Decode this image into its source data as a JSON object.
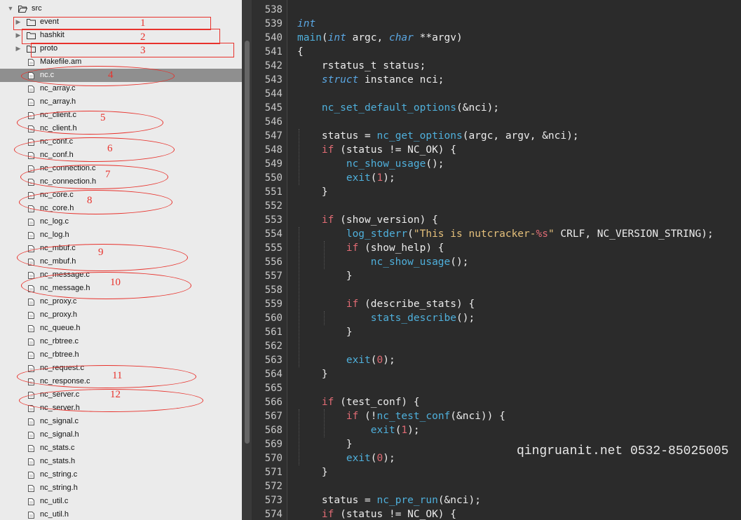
{
  "sidebar": {
    "root": {
      "label": "src",
      "expanded": true
    },
    "folders": [
      {
        "label": "event",
        "expanded": false
      },
      {
        "label": "hashkit",
        "expanded": false
      },
      {
        "label": "proto",
        "expanded": false
      }
    ],
    "files": [
      {
        "label": "Makefile.am",
        "selected": false
      },
      {
        "label": "nc.c",
        "selected": true
      },
      {
        "label": "nc_array.c"
      },
      {
        "label": "nc_array.h"
      },
      {
        "label": "nc_client.c"
      },
      {
        "label": "nc_client.h"
      },
      {
        "label": "nc_conf.c"
      },
      {
        "label": "nc_conf.h"
      },
      {
        "label": "nc_connection.c"
      },
      {
        "label": "nc_connection.h"
      },
      {
        "label": "nc_core.c"
      },
      {
        "label": "nc_core.h"
      },
      {
        "label": "nc_log.c"
      },
      {
        "label": "nc_log.h"
      },
      {
        "label": "nc_mbuf.c"
      },
      {
        "label": "nc_mbuf.h"
      },
      {
        "label": "nc_message.c"
      },
      {
        "label": "nc_message.h"
      },
      {
        "label": "nc_proxy.c"
      },
      {
        "label": "nc_proxy.h"
      },
      {
        "label": "nc_queue.h"
      },
      {
        "label": "nc_rbtree.c"
      },
      {
        "label": "nc_rbtree.h"
      },
      {
        "label": "nc_request.c"
      },
      {
        "label": "nc_response.c"
      },
      {
        "label": "nc_server.c"
      },
      {
        "label": "nc_server.h"
      },
      {
        "label": "nc_signal.c"
      },
      {
        "label": "nc_signal.h"
      },
      {
        "label": "nc_stats.c"
      },
      {
        "label": "nc_stats.h"
      },
      {
        "label": "nc_string.c"
      },
      {
        "label": "nc_string.h"
      },
      {
        "label": "nc_util.c"
      },
      {
        "label": "nc_util.h"
      }
    ]
  },
  "annotations": [
    "1",
    "2",
    "3",
    "4",
    "5",
    "6",
    "7",
    "8",
    "9",
    "10",
    "11",
    "12"
  ],
  "colors": {
    "annotation": "#e8322c",
    "keyword": "#5aa7e3",
    "function": "#4fb0dc",
    "control": "#e06b74",
    "string": "#e5c07b"
  },
  "editor": {
    "lines": [
      {
        "n": "538",
        "t": []
      },
      {
        "n": "539",
        "t": [
          [
            "kw",
            "int"
          ]
        ]
      },
      {
        "n": "540",
        "t": [
          [
            "fn",
            "main"
          ],
          [
            "p",
            "("
          ],
          [
            "kw",
            "int"
          ],
          [
            "p",
            " argc, "
          ],
          [
            "kw",
            "char"
          ],
          [
            "p",
            " **argv)"
          ]
        ]
      },
      {
        "n": "541",
        "t": [
          [
            "p",
            "{"
          ]
        ]
      },
      {
        "n": "542",
        "t": [
          [
            "p",
            "    rstatus_t status;"
          ]
        ]
      },
      {
        "n": "543",
        "t": [
          [
            "p",
            "    "
          ],
          [
            "kw",
            "struct"
          ],
          [
            "p",
            " instance nci;"
          ]
        ]
      },
      {
        "n": "544",
        "t": []
      },
      {
        "n": "545",
        "t": [
          [
            "p",
            "    "
          ],
          [
            "fn",
            "nc_set_default_options"
          ],
          [
            "p",
            "(&nci);"
          ]
        ]
      },
      {
        "n": "546",
        "t": []
      },
      {
        "n": "547",
        "t": [
          [
            "p",
            "    status = "
          ],
          [
            "fn",
            "nc_get_options"
          ],
          [
            "p",
            "(argc, argv, &nci);"
          ]
        ]
      },
      {
        "n": "548",
        "t": [
          [
            "p",
            "    "
          ],
          [
            "kwd",
            "if"
          ],
          [
            "p",
            " (status != NC_OK) {"
          ]
        ]
      },
      {
        "n": "549",
        "t": [
          [
            "p",
            "        "
          ],
          [
            "fn",
            "nc_show_usage"
          ],
          [
            "p",
            "();"
          ]
        ]
      },
      {
        "n": "550",
        "t": [
          [
            "p",
            "        "
          ],
          [
            "fn",
            "exit"
          ],
          [
            "p",
            "("
          ],
          [
            "num",
            "1"
          ],
          [
            "p",
            ");"
          ]
        ]
      },
      {
        "n": "551",
        "t": [
          [
            "p",
            "    }"
          ]
        ]
      },
      {
        "n": "552",
        "t": []
      },
      {
        "n": "553",
        "t": [
          [
            "p",
            "    "
          ],
          [
            "kwd",
            "if"
          ],
          [
            "p",
            " (show_version) {"
          ]
        ]
      },
      {
        "n": "554",
        "t": [
          [
            "p",
            "        "
          ],
          [
            "fn",
            "log_stderr"
          ],
          [
            "p",
            "("
          ],
          [
            "str",
            "\"This is nutcracker-"
          ],
          [
            "num",
            "%s"
          ],
          [
            "str",
            "\""
          ],
          [
            "p",
            " CRLF, NC_VERSION_STRING);"
          ]
        ]
      },
      {
        "n": "555",
        "t": [
          [
            "p",
            "        "
          ],
          [
            "kwd",
            "if"
          ],
          [
            "p",
            " (show_help) {"
          ]
        ]
      },
      {
        "n": "556",
        "t": [
          [
            "p",
            "            "
          ],
          [
            "fn",
            "nc_show_usage"
          ],
          [
            "p",
            "();"
          ]
        ]
      },
      {
        "n": "557",
        "t": [
          [
            "p",
            "        }"
          ]
        ]
      },
      {
        "n": "558",
        "t": []
      },
      {
        "n": "559",
        "t": [
          [
            "p",
            "        "
          ],
          [
            "kwd",
            "if"
          ],
          [
            "p",
            " (describe_stats) {"
          ]
        ]
      },
      {
        "n": "560",
        "t": [
          [
            "p",
            "            "
          ],
          [
            "fn",
            "stats_describe"
          ],
          [
            "p",
            "();"
          ]
        ]
      },
      {
        "n": "561",
        "t": [
          [
            "p",
            "        }"
          ]
        ]
      },
      {
        "n": "562",
        "t": []
      },
      {
        "n": "563",
        "t": [
          [
            "p",
            "        "
          ],
          [
            "fn",
            "exit"
          ],
          [
            "p",
            "("
          ],
          [
            "num",
            "0"
          ],
          [
            "p",
            ");"
          ]
        ]
      },
      {
        "n": "564",
        "t": [
          [
            "p",
            "    }"
          ]
        ]
      },
      {
        "n": "565",
        "t": []
      },
      {
        "n": "566",
        "t": [
          [
            "p",
            "    "
          ],
          [
            "kwd",
            "if"
          ],
          [
            "p",
            " (test_conf) {"
          ]
        ]
      },
      {
        "n": "567",
        "t": [
          [
            "p",
            "        "
          ],
          [
            "kwd",
            "if"
          ],
          [
            "p",
            " (!"
          ],
          [
            "fn",
            "nc_test_conf"
          ],
          [
            "p",
            "(&nci)) {"
          ]
        ]
      },
      {
        "n": "568",
        "t": [
          [
            "p",
            "            "
          ],
          [
            "fn",
            "exit"
          ],
          [
            "p",
            "("
          ],
          [
            "num",
            "1"
          ],
          [
            "p",
            ");"
          ]
        ]
      },
      {
        "n": "569",
        "t": [
          [
            "p",
            "        }"
          ]
        ]
      },
      {
        "n": "570",
        "t": [
          [
            "p",
            "        "
          ],
          [
            "fn",
            "exit"
          ],
          [
            "p",
            "("
          ],
          [
            "num",
            "0"
          ],
          [
            "p",
            ");"
          ]
        ]
      },
      {
        "n": "571",
        "t": [
          [
            "p",
            "    }"
          ]
        ]
      },
      {
        "n": "572",
        "t": []
      },
      {
        "n": "573",
        "t": [
          [
            "p",
            "    status = "
          ],
          [
            "fn",
            "nc_pre_run"
          ],
          [
            "p",
            "(&nci);"
          ]
        ]
      },
      {
        "n": "574",
        "t": [
          [
            "p",
            "    "
          ],
          [
            "kwd",
            "if"
          ],
          [
            "p",
            " (status != NC_OK) {"
          ]
        ]
      }
    ]
  },
  "watermark": "qingruanit.net 0532-85025005"
}
